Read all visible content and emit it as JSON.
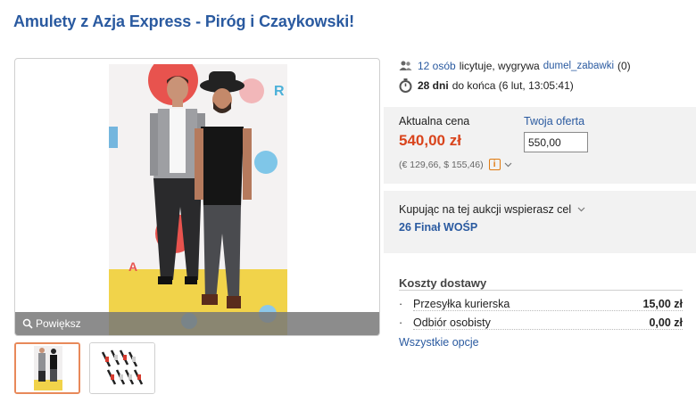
{
  "title": "Amulety z Azja Express - Piróg i Czaykowski!",
  "gallery": {
    "zoom_label": "Powiększ"
  },
  "bidders": {
    "count_link": "12 osób",
    "text": "licytuje, wygrywa",
    "winner_link": "dumel_zabawki",
    "winner_score": "(0)"
  },
  "time_left": {
    "days": "28 dni",
    "text": "do końca (6 lut, 13:05:41)"
  },
  "price": {
    "label": "Aktualna cena",
    "value": "540,00 zł",
    "conversion": "(€ 129,66, $ 155,46)",
    "info_badge": "i"
  },
  "offer": {
    "label": "Twoja oferta",
    "value": "550,00"
  },
  "support": {
    "text": "Kupując na tej aukcji wspierasz cel",
    "cause": "26 Finał WOŚP"
  },
  "shipping": {
    "title": "Koszty dostawy",
    "rows": [
      {
        "name": "Przesyłka kurierska",
        "value": "15,00 zł"
      },
      {
        "name": "Odbiór osobisty",
        "value": "0,00 zł"
      }
    ],
    "all_options": "Wszystkie opcje"
  },
  "colors": {
    "link": "#2a5aa0",
    "price": "#d9441c",
    "thumb_active_border": "#e8895a"
  },
  "icons": {
    "people": "people-icon",
    "timer": "stopwatch-icon",
    "zoom": "magnifier-icon"
  }
}
